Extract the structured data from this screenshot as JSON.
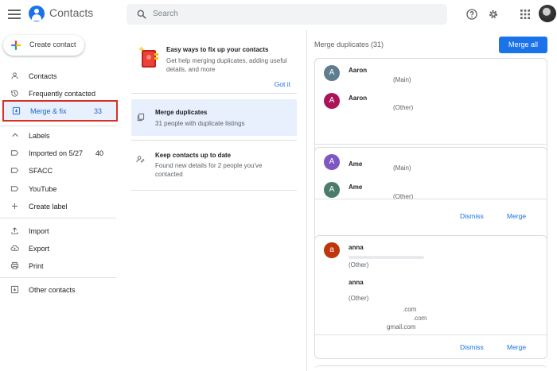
{
  "header": {
    "app_title": "Contacts",
    "search_placeholder": "Search",
    "icons": [
      "menu-icon",
      "contacts-logo-icon",
      "search-icon",
      "help-icon",
      "gear-icon",
      "apps-grid-icon",
      "account-avatar"
    ]
  },
  "sidebar": {
    "create_label": "Create contact",
    "items": [
      {
        "label": "Contacts",
        "icon": "person-icon"
      },
      {
        "label": "Frequently contacted",
        "icon": "history-icon"
      },
      {
        "label": "Merge & fix",
        "count": "33",
        "icon": "merge-fix-icon"
      }
    ],
    "labels_heading": "Labels",
    "labels": [
      {
        "label": "Imported on 5/27",
        "count": "40"
      },
      {
        "label": "SFACC",
        "count": ""
      },
      {
        "label": "YouTube",
        "count": ""
      }
    ],
    "create_label_text": "Create label",
    "tools": [
      {
        "label": "Import",
        "icon": "import-icon"
      },
      {
        "label": "Export",
        "icon": "export-icon"
      },
      {
        "label": "Print",
        "icon": "print-icon"
      }
    ],
    "other_contacts": "Other contacts"
  },
  "tips": {
    "title": "Easy ways to fix up your contacts",
    "desc": "Get help merging duplicates, adding useful details, and more",
    "got_it": "Got it"
  },
  "options": [
    {
      "title": "Merge duplicates",
      "desc": "31 people with duplicate listings"
    },
    {
      "title": "Keep contacts up to date",
      "desc": "Found new details for 2 people you've contacted"
    }
  ],
  "merge": {
    "header": "Merge duplicates (31)",
    "merge_all": "Merge all",
    "dismiss": "Dismiss",
    "merge": "Merge",
    "cards": [
      {
        "contacts": [
          {
            "initial": "A",
            "name": "Aaron",
            "label": "(Main)",
            "color": "#5f7d8f"
          },
          {
            "initial": "A",
            "name": "Aaron",
            "label": "(Other)",
            "color": "#ad1457"
          }
        ]
      },
      {
        "contacts": [
          {
            "initial": "A",
            "name": "Ame",
            "label": "(Main)",
            "color": "#7e57c2"
          },
          {
            "initial": "A",
            "name": "Ame",
            "label": "(Other)",
            "color": "#4a7b6c"
          }
        ]
      },
      {
        "contacts": [
          {
            "initial": "a",
            "name": "anna",
            "label": "(Other)",
            "color": "#bf360c"
          },
          {
            "initial": "",
            "name": "anna",
            "label": "(Other)",
            "color": ""
          }
        ],
        "emails": [
          ".com",
          ".com",
          "gmail.com"
        ]
      }
    ]
  },
  "colors": {
    "accent": "#1a73e8",
    "active_bg": "#e8f0fe",
    "highlight_border": "#d93025"
  }
}
